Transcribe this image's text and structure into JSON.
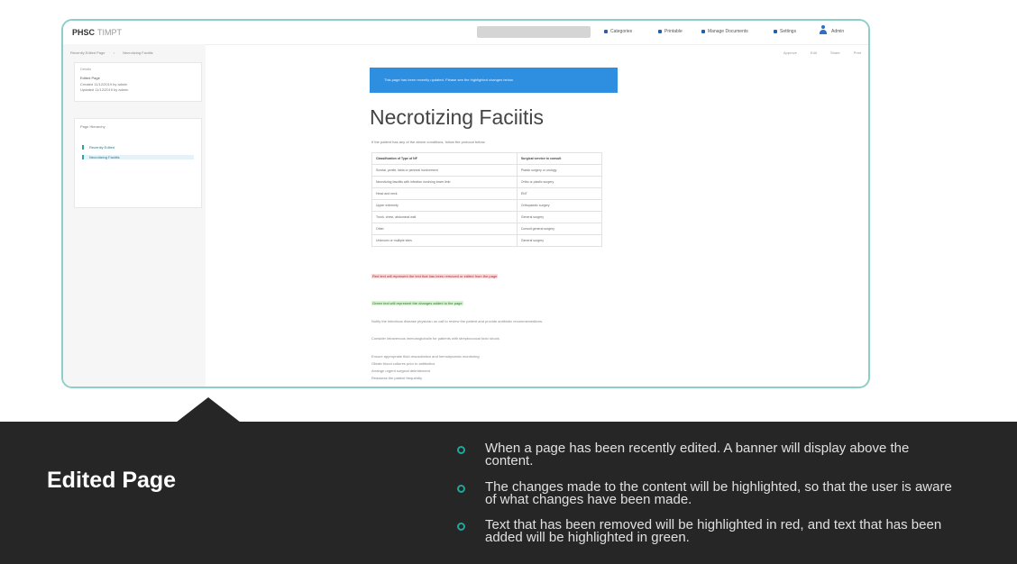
{
  "app": {
    "logo": "PHSC",
    "logo_sub": "TIMPT",
    "nav": [
      "Categories",
      "Printable",
      "Manage Documents",
      "Settings"
    ],
    "user": "Admin"
  },
  "breadcrumb": [
    "Recently Edited Page",
    "Necrotizing Faciitis"
  ],
  "actions": [
    "Approve",
    "Edit",
    "Share",
    "Print"
  ],
  "sidebar": {
    "header": "Details",
    "lines": [
      "Edited Page",
      "Created 11/12/2019 by admin",
      "Updated 11/12/2019 by admin"
    ],
    "section": "Page Hierarchy",
    "tree": [
      "Recently Edited",
      "Necrotizing Faciitis"
    ]
  },
  "page": {
    "banner": "This page has been recently updated. Please see the highlighted changes below.",
    "title": "Necrotizing Faciitis",
    "intro": "If the patient has any of the above conditions, follow the protocol below:",
    "table": [
      [
        "Classification of Type of NF",
        "Surgical service to consult"
      ],
      [
        "Scrotal, penile, labia or perineal involvement",
        "Plastic surgery or urology"
      ],
      [
        "Necrotizing fasciitis with infection involving lower limb",
        "Ortho or plastic surgery"
      ],
      [
        "Head and neck",
        "ENT"
      ],
      [
        "Upper extremity",
        "Orthopaedic surgery"
      ],
      [
        "Trunk, chest, abdominal wall",
        "General surgery"
      ],
      [
        "Other",
        "Consult general surgery"
      ],
      [
        "Unknown or multiple sites",
        "General surgery"
      ]
    ],
    "removed_text": "Red text will represent the text that has been removed or edited from the page",
    "added_text": "Green text will represent the changes added to the page",
    "para1": "Notify the infectious disease physician on call to review the patient and provide antibiotic recommendations.",
    "para2": "Consider intravenous immunoglobulin for patients with streptococcal toxic shock.",
    "list": [
      "Ensure appropriate fluid resuscitation and hemodynamic monitoring",
      "Obtain blood cultures prior to antibiotics",
      "Arrange urgent surgical debridement",
      "Reassess the patient frequently"
    ]
  },
  "slide": {
    "heading": "Edited Page",
    "bullets": [
      "When a page has been recently edited. A banner will display above the content.",
      "The changes made to the content will be highlighted, so that the user is aware of what changes have been made.",
      "Text that has been removed will be highlighted in red, and text that has been added will be highlighted in green."
    ]
  },
  "colors": {
    "accent_teal": "#1fa79a",
    "frame_border": "#8ccfc8",
    "banner_blue": "#2e8fe0",
    "dark_panel": "#262626",
    "removed_red": "#b12a2a",
    "added_green": "#2c7a2c"
  }
}
